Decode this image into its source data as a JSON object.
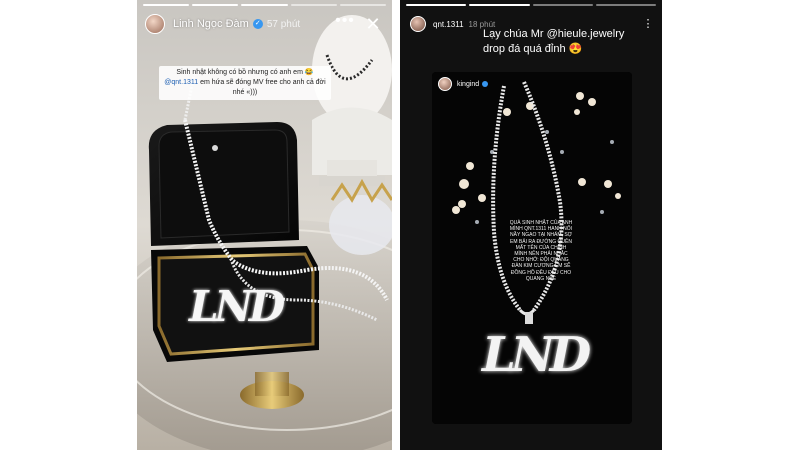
{
  "story1": {
    "username": "Linh Ngọc Đàm",
    "time": "57 phút",
    "caption_line1": "Sinh nhật không có bồ nhưng có anh em 😂",
    "caption_mention": "@qnt.1311",
    "caption_rest": "em hứa sẽ đóng MV free cho anh cả đời nhé «)))",
    "pendant_text": "LND"
  },
  "story2": {
    "username": "qnt.1311",
    "time": "18 phút",
    "caption": "Lạy chúa Mr @hieule.jewelry drop đá quá đỉnh 😍",
    "inner_username": "kingind",
    "note": "QUÀ SINH NHẬT CỦA ANH MÌNH QNT.1311 HANH NỐI NẦY NGẠO TẠI NHẨM, SỢ EM BẢI RA ĐƯỜNG QUÊN MẤT TÊN CỦA CHÍNH MÌNH NÊN PHẢI NHẮC CHO NHỚ: ĐỘI QUANG ĐÀN KIM CƯƠNG EM SẼ ĐỒNG HỒ ĐỀU ĐỀU CHO QUANG NHÉ",
    "pendant_text": "LND"
  },
  "colors": {
    "verified": "#3897f0",
    "story2_bg": "#111111"
  },
  "icons": {
    "more": "more-horizontal-icon",
    "close": "close-icon",
    "more_vertical": "more-vertical-icon"
  }
}
